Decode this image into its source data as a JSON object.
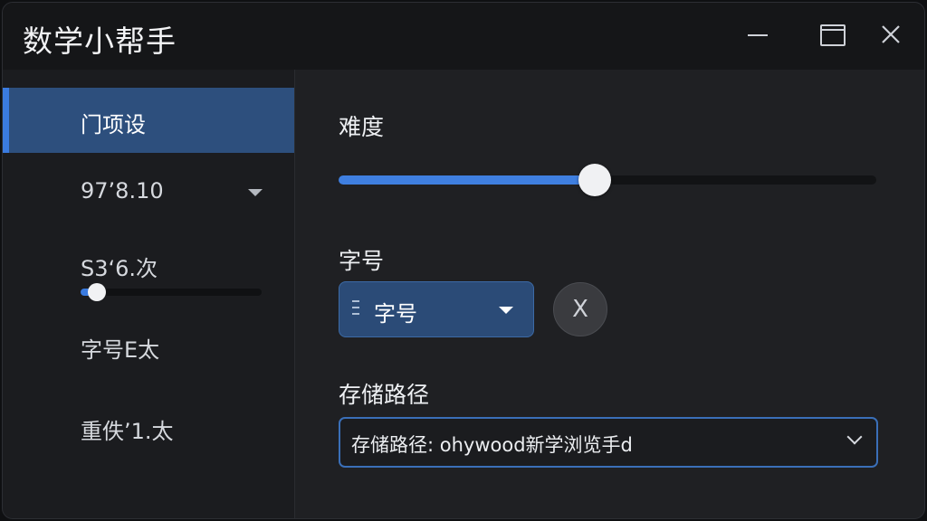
{
  "window": {
    "title": "数学小帮手"
  },
  "sidebar": {
    "items": [
      {
        "label": "门项设"
      },
      {
        "label": "97’8.10"
      },
      {
        "label": "S3‘6.次"
      },
      {
        "label": "字号E太"
      },
      {
        "label": "重佚’1.太"
      }
    ],
    "mini_slider": {
      "value_fraction": 0.09
    }
  },
  "difficulty": {
    "label": "难度",
    "value_fraction": 0.477
  },
  "font_size": {
    "label": "字号",
    "selected": "字号",
    "clear_label": "X"
  },
  "storage": {
    "label": "存储路径",
    "value": "存储路径: ohywood新学浏览手d"
  },
  "colors": {
    "accent": "#3f7fe0",
    "active_nav": "#2d4f7d",
    "titlebar": "#151618",
    "window_bg": "#1f2023"
  }
}
